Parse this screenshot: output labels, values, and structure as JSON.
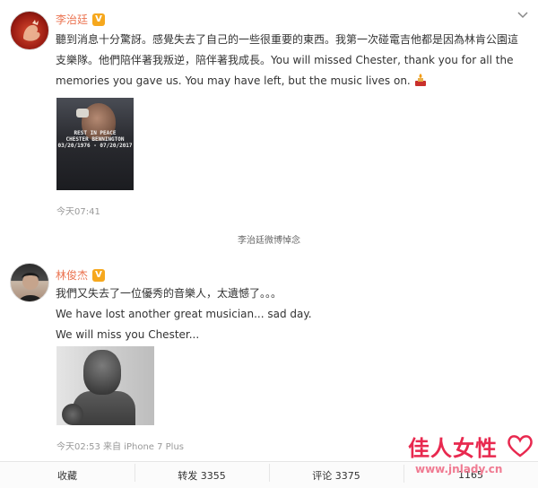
{
  "post1": {
    "author": "李治廷",
    "verified_badge": "V",
    "lines": [
      "聽到消息十分驚訝。感覺失去了自己的一些很重要的東西。我第一次碰電吉他都是因為林肯公園這",
      "支樂隊。他們陪伴著我叛逆，陪伴著我成長。You will missed Chester, thank you for all the",
      "memories you gave us. You may have left, but the music lives on."
    ],
    "image_caption": [
      "REST IN PEACE",
      "CHESTER BENNINGTON",
      "03/20/1976 - 07/20/2017"
    ],
    "time": "今天07:41"
  },
  "divider_label": "李治廷微博悼念",
  "post2": {
    "author": "林俊杰",
    "verified_badge": "V",
    "lines": [
      "我們又失去了一位優秀的音樂人，太遺憾了。。。",
      "We have lost another great musician... sad day.",
      "We will miss you Chester..."
    ],
    "meta": "今天02:53 来自 iPhone 7 Plus"
  },
  "footer": {
    "collect": "收藏",
    "repost": "转发 3355",
    "comment": "评论 3375",
    "like": "1165"
  },
  "watermark": {
    "title": "佳人女性",
    "url": "www.jnlady.cn"
  },
  "colors": {
    "author": "#eb7350",
    "watermark": "#e8294f"
  }
}
